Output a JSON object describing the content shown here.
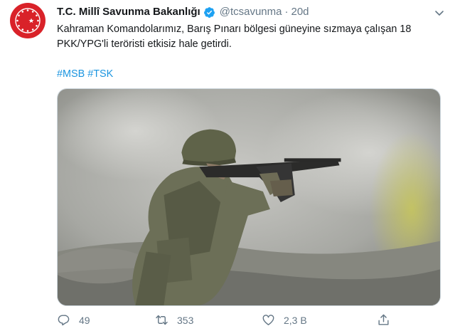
{
  "tweet": {
    "account_name": "T.C. Millî Savunma Bakanlığı",
    "handle": "@tcsavunma",
    "separator": "·",
    "time": "20d",
    "text": "Kahraman Komandolarımız, Barış Pınarı bölgesi güneyine sızmaya çalışan 18 PKK/YPG'li teröristi etkisiz hale getirdi.",
    "hashtags": [
      "#MSB",
      "#TSK"
    ],
    "media_icon": "soldier-photo",
    "actions": {
      "reply_count": "49",
      "retweet_count": "353",
      "like_count": "2,3 B"
    }
  },
  "colors": {
    "text": "#14171a",
    "muted": "#657786",
    "link": "#1b95e0",
    "verified": "#1da1f2",
    "avatar_red": "#d92229"
  },
  "icons": {
    "avatar": "msb-emblem-icon",
    "verified": "verified-badge-icon",
    "menu": "chevron-down-icon",
    "reply": "reply-icon",
    "retweet": "retweet-icon",
    "like": "heart-icon",
    "share": "share-icon"
  }
}
